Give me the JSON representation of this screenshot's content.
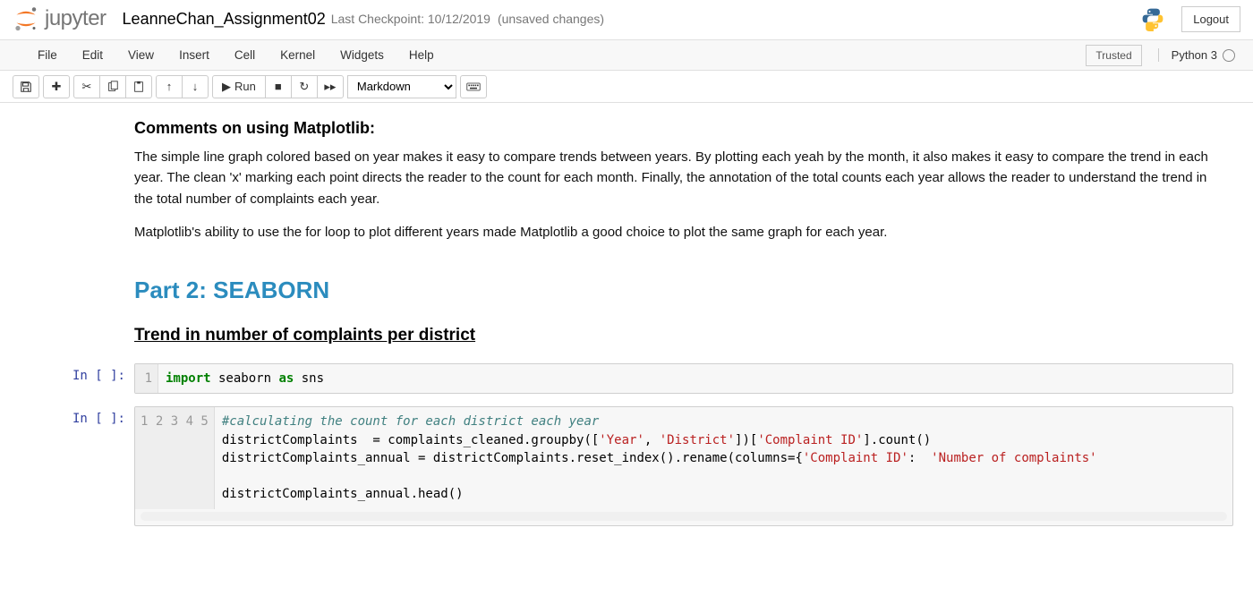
{
  "header": {
    "brand": "jupyter",
    "title": "LeanneChan_Assignment02",
    "checkpoint": "Last Checkpoint: 10/12/2019",
    "unsaved": "(unsaved changes)",
    "logout": "Logout"
  },
  "menubar": {
    "items": [
      "File",
      "Edit",
      "View",
      "Insert",
      "Cell",
      "Kernel",
      "Widgets",
      "Help"
    ],
    "trusted": "Trusted",
    "kernel": "Python 3"
  },
  "toolbar": {
    "run_label": "Run",
    "cell_type": "Markdown"
  },
  "content": {
    "h3_matplotlib": "Comments on using Matplotlib:",
    "p1": "The simple line graph colored based on year makes it easy to compare trends between years. By plotting each yeah by the month, it also makes it easy to compare the trend in each year. The clean 'x' marking each point directs the reader to the count for each month. Finally, the annotation of the total counts each year allows the reader to understand the trend in the total number of complaints each year.",
    "p2": "Matplotlib's ability to use the for loop to plot different years made Matplotlib a good choice to plot the same graph for each year.",
    "h2_seaborn": "Part 2: SEABORN",
    "h3_trend": "Trend in number of complaints per district"
  },
  "cells": {
    "prompt1": "In [ ]:",
    "prompt2": "In [ ]:",
    "c1_g": "1",
    "c1_import": "import",
    "c1_sp": " seaborn ",
    "c1_as": "as",
    "c1_sns": " sns",
    "c2_g": "1\n2\n3\n4\n5",
    "c2_l1": "#calculating the count for each district each year",
    "c2_l2a": "districtComplaints  = complaints_cleaned.groupby([",
    "c2_s_year": "'Year'",
    "c2_comma": ", ",
    "c2_s_district": "'District'",
    "c2_l2b": "])[",
    "c2_s_cid1": "'Complaint ID'",
    "c2_l2c": "].count()",
    "c2_l3a": "districtComplaints_annual = districtComplaints.reset_index().rename(columns={",
    "c2_s_cid2": "'Complaint ID'",
    "c2_colon": ": ",
    "c2_s_num": " 'Number of complaints'",
    "c2_l5": "districtComplaints_annual.head()"
  }
}
